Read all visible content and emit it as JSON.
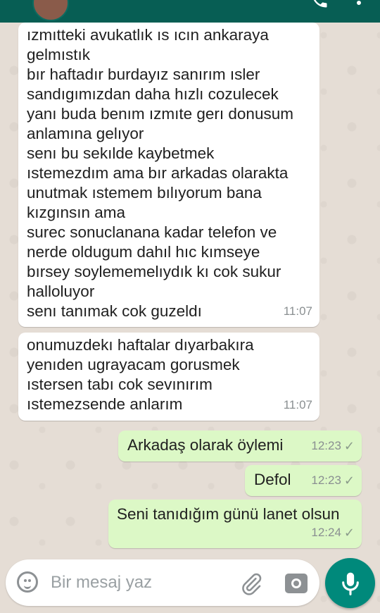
{
  "chat": {
    "messages": [
      {
        "direction": "incoming",
        "text": "ızmıtteki avukatlık ıs ıcın ankaraya\ngelmıstık\nbır haftadır burdayız sanırım ısler\nsandıgımızdan daha hızlı cozulecek\nyanı buda benım ızmıte gerı donusum\nanlamına gelıyor\nsenı bu sekılde kaybetmek\nıstemezdım ama bır arkadas olarakta\nunutmak ıstemem bılıyorum bana\nkızgınsın ama\nsurec sonuclanana kadar telefon ve\nnerde oldugum dahıl hıc kımseye\nbırsey soylememelıydık kı cok sukur\nhalloluyor\nsenı tanımak cok guzeldı",
        "time": "11:07"
      },
      {
        "direction": "incoming",
        "text": "onumuzdekı haftalar dıyarbakıra\nyenıden ugrayacam gorusmek\nıstersen tabı cok sevınırım\nıstemezsende anlarım",
        "time": "11:07"
      },
      {
        "direction": "outgoing",
        "text": "Arkadaş olarak öylemi",
        "time": "12:23",
        "tick": "✓"
      },
      {
        "direction": "outgoing",
        "text": "Defol",
        "time": "12:23",
        "tick": "✓"
      },
      {
        "direction": "outgoing",
        "text": "Seni tanıdığım günü lanet olsun",
        "time": "12:24",
        "tick": "✓"
      }
    ]
  },
  "composer": {
    "placeholder": "Bir mesaj yaz",
    "emoji_icon": "emoji-icon",
    "attach_icon": "paperclip-icon",
    "camera_icon": "camera-icon",
    "mic_icon": "microphone-icon"
  },
  "colors": {
    "header": "#075e54",
    "incoming_bubble": "#ffffff",
    "outgoing_bubble": "#dcf8c6",
    "mic_button": "#00897b",
    "background": "#e5ddd5"
  }
}
